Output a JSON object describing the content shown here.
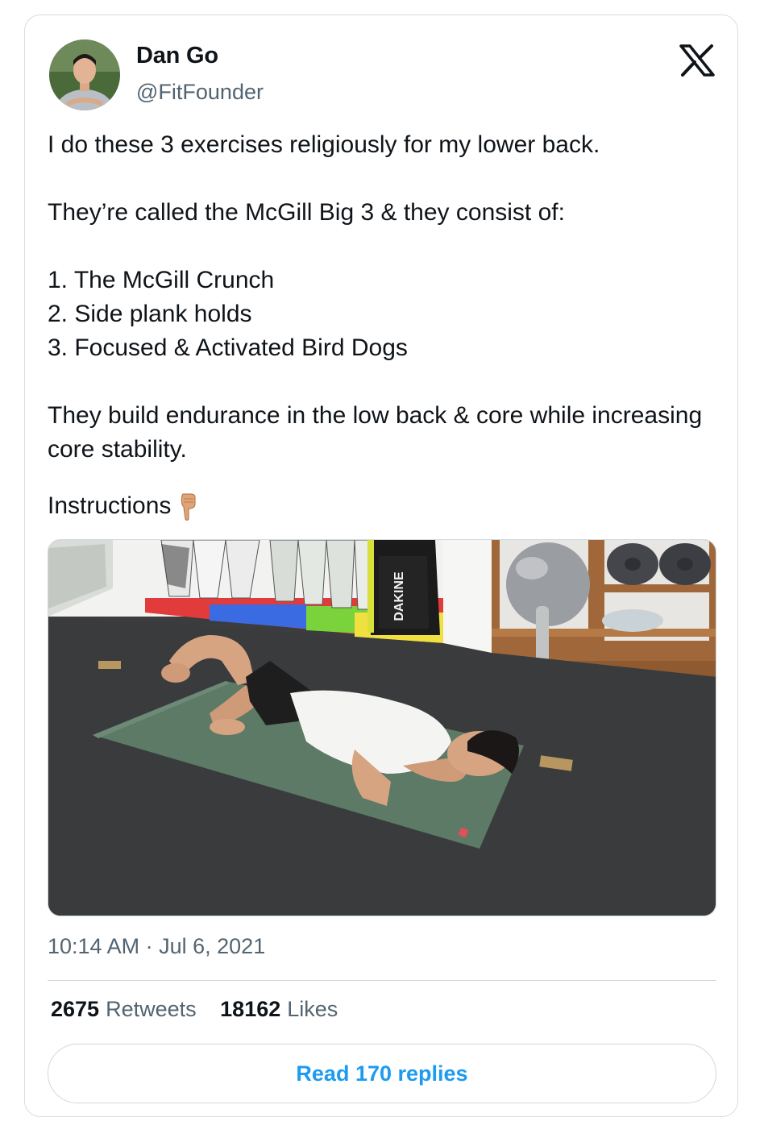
{
  "author": {
    "display_name": "Dan Go",
    "handle": "@FitFounder"
  },
  "brand": {
    "logo_icon": "x-logo-icon",
    "link_color": "#1d9bf0",
    "muted_color": "#536471"
  },
  "tweet": {
    "lines": [
      "I do these 3 exercises religiously for my lower back.",
      "",
      "They’re called the McGill Big 3 & they consist of:",
      "",
      "1. The McGill Crunch",
      "2. Side plank holds",
      "3. Focused & Activated Bird Dogs",
      "",
      "They build endurance in the low back & core while increasing core stability.",
      "",
      "Instructions"
    ],
    "emoji_icon": "backhand-index-pointing-down-icon",
    "media_icon": "video-thumbnail-man-on-yoga-mat",
    "media_logo": "DAKINE"
  },
  "meta": {
    "time": "10:14 AM",
    "separator": "·",
    "date": "Jul 6, 2021"
  },
  "stats": {
    "retweets_count": "2675",
    "retweets_label": "Retweets",
    "likes_count": "18162",
    "likes_label": "Likes"
  },
  "actions": {
    "read_replies": "Read 170 replies"
  }
}
